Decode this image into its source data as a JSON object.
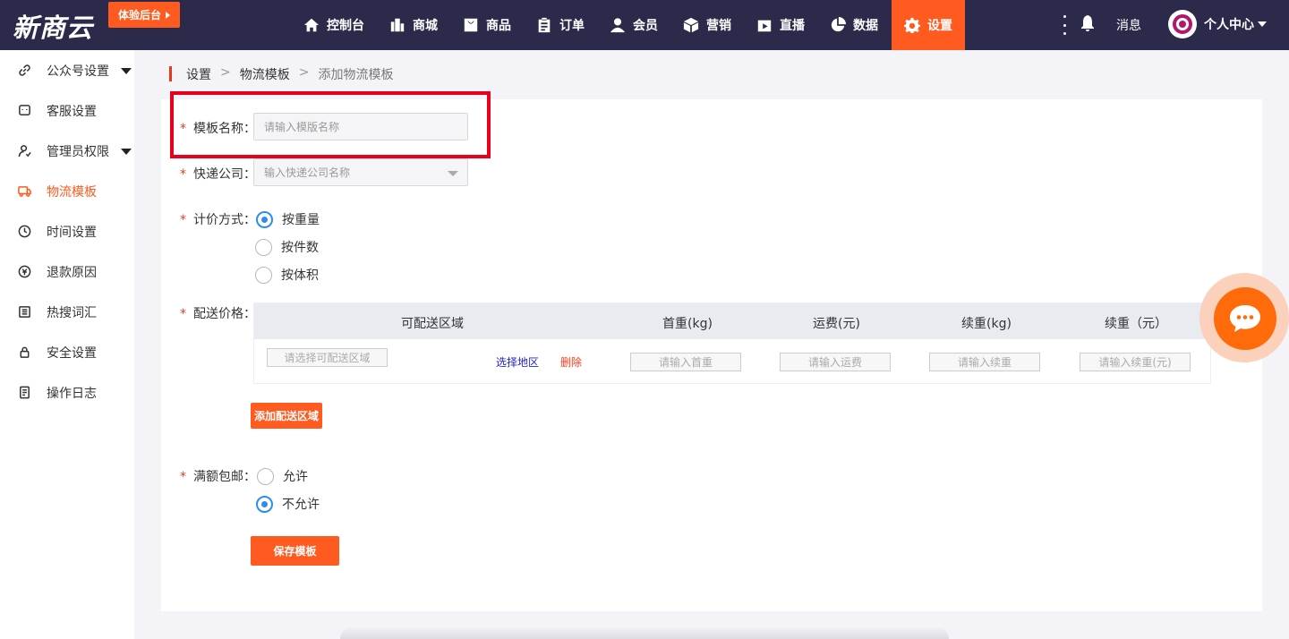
{
  "header": {
    "logo": "新商云",
    "trial_button": "体验后台",
    "nav": [
      {
        "label": "控制台",
        "icon": "home-icon"
      },
      {
        "label": "商城",
        "icon": "building-icon"
      },
      {
        "label": "商品",
        "icon": "bag-icon"
      },
      {
        "label": "订单",
        "icon": "clipboard-icon"
      },
      {
        "label": "会员",
        "icon": "user-icon"
      },
      {
        "label": "营销",
        "icon": "box-icon"
      },
      {
        "label": "直播",
        "icon": "play-icon"
      },
      {
        "label": "数据",
        "icon": "pie-chart-icon"
      },
      {
        "label": "设置",
        "icon": "gear-icon",
        "active": true
      }
    ],
    "messages_label": "消息",
    "personal_center": "个人中心"
  },
  "sidebar": {
    "items": [
      {
        "label": "公众号设置",
        "icon": "link-icon",
        "expandable": true
      },
      {
        "label": "客服设置",
        "icon": "chat-box-icon"
      },
      {
        "label": "管理员权限",
        "icon": "admin-user-icon",
        "expandable": true
      },
      {
        "label": "物流模板",
        "icon": "truck-icon",
        "active": true
      },
      {
        "label": "时间设置",
        "icon": "clock-icon"
      },
      {
        "label": "退款原因",
        "icon": "refund-icon"
      },
      {
        "label": "热搜词汇",
        "icon": "list-icon"
      },
      {
        "label": "安全设置",
        "icon": "lock-icon"
      },
      {
        "label": "操作日志",
        "icon": "log-icon"
      }
    ]
  },
  "breadcrumb": {
    "level1": "设置",
    "level2": "物流模板",
    "current": "添加物流模板",
    "separator": ">"
  },
  "form": {
    "template_name": {
      "label": "模板名称：",
      "placeholder": "请输入模版名称",
      "value": ""
    },
    "express_company": {
      "label": "快递公司：",
      "placeholder": "输入快递公司名称"
    },
    "pricing_method": {
      "label": "计价方式：",
      "options": [
        "按重量",
        "按件数",
        "按体积"
      ],
      "selected": "按重量"
    },
    "delivery_price": {
      "label": "配送价格：",
      "columns": [
        "可配送区域",
        "首重(kg)",
        "运费(元)",
        "续重(kg)",
        "续重（元）"
      ],
      "row": {
        "region_placeholder": "请选择可配送区域",
        "select_region": "选择地区",
        "delete": "删除",
        "first_weight_placeholder": "请输入首重",
        "freight_placeholder": "请输入运费",
        "extra_weight_placeholder": "请输入续重",
        "extra_fee_placeholder": "请输入续重(元)"
      },
      "add_button": "添加配送区域"
    },
    "free_shipping": {
      "label": "满额包邮：",
      "options": [
        "允许",
        "不允许"
      ],
      "selected": "不允许"
    },
    "save_button": "保存模板"
  },
  "colors": {
    "topbar": "#2c2a4a",
    "accent": "#ff5a1f",
    "radio_selected": "#2d8cf0",
    "highlight": "#e8001c"
  }
}
